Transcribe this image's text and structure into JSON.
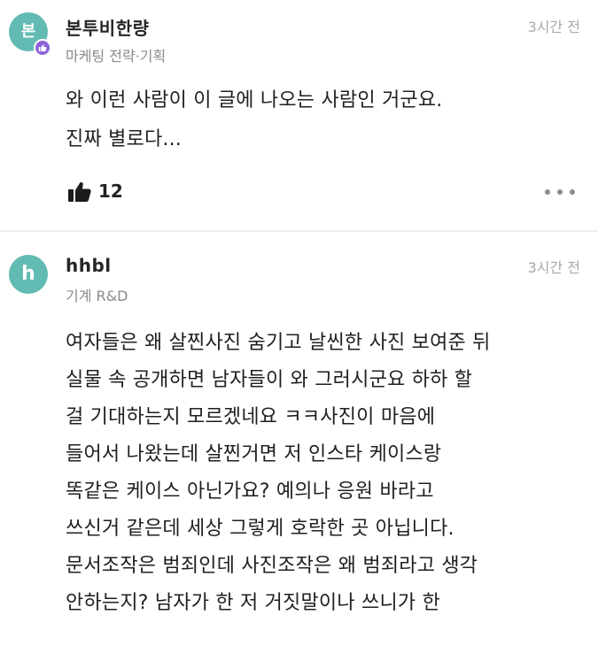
{
  "comments": [
    {
      "avatar_text": "본",
      "author": "본투비한량",
      "job": "마케팅 전략·기획",
      "time": "3시간 전",
      "lines": [
        "와 이런 사람이 이 글에 나오는 사람인 거군요.",
        "진짜 별로다..."
      ],
      "likes": "12",
      "badge_icon": "thumbs-up-icon",
      "like_icon": "thumbs-up-icon",
      "more_icon": "more-dots-icon"
    },
    {
      "avatar_text": "h",
      "author": "hhbl",
      "job": "기계 R&D",
      "time": "3시간 전",
      "lines": [
        "여자들은 왜 살찐사진 숨기고 날씬한 사진 보여준 뒤",
        "실물 속 공개하면 남자들이 와 그러시군요 하하 할",
        "걸 기대하는지 모르겠네요 ㅋㅋ사진이 마음에",
        "들어서 나왔는데 살찐거면 저 인스타 케이스랑",
        "똑같은 케이스 아닌가요? 예의나 응원 바라고",
        "쓰신거 같은데 세상 그렇게 호락한 곳 아닙니다.",
        "문서조작은 범죄인데 사진조작은 왜 범죄라고 생각",
        "안하는지? 남자가 한 저 거짓말이나 쓰니가 한"
      ]
    }
  ],
  "colors": {
    "avatar_bg": "#62bbb2",
    "badge_bg": "#8b63d6",
    "meta_text": "#8a8a8a",
    "time_text": "#a8a8a8"
  }
}
